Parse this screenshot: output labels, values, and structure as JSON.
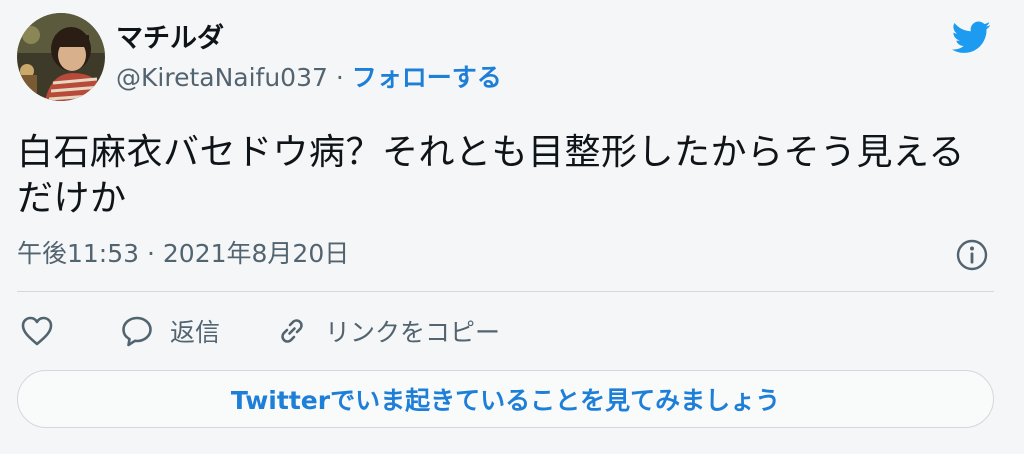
{
  "author": {
    "display_name": "マチルダ",
    "handle": "@KiretaNaifu037",
    "separator": " · ",
    "follow_label": "フォローする"
  },
  "tweet": {
    "text": "白石麻衣バセドウ病？それとも目整形したからそう見えるだけか",
    "timestamp": "午後11:53 · 2021年8月20日"
  },
  "actions": {
    "like_label": "",
    "reply_label": "返信",
    "copy_link_label": "リンクをコピー"
  },
  "cta": {
    "label": "Twitterでいま起きていることを見てみましょう"
  },
  "icons": {
    "brand": "twitter-bird-icon",
    "info": "info-icon",
    "like": "heart-icon",
    "reply": "speech-bubble-icon",
    "copy": "link-icon"
  },
  "colors": {
    "brand": "#1d9bf0",
    "link": "#1d7fd8",
    "text": "#0f1419",
    "secondary": "#536471",
    "border": "#cfd9de"
  }
}
